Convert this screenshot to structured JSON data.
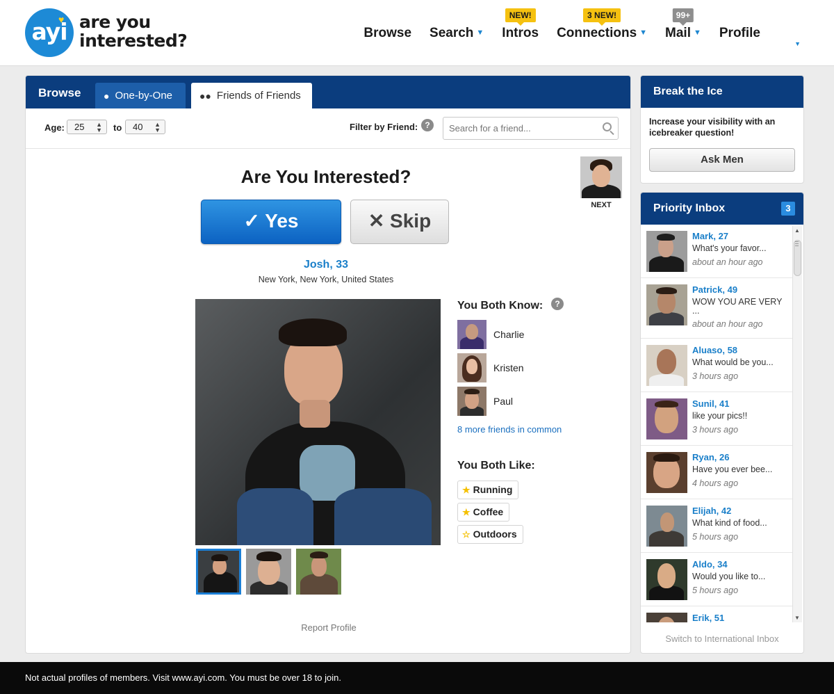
{
  "brand": {
    "logo_mark": "ayi",
    "logo_line1": "are you",
    "logo_line2": "interested?",
    "heart_color": "#ffd21f",
    "brand_blue": "#1d8ad6"
  },
  "nav": {
    "browse": "Browse",
    "search": "Search",
    "intros": "Intros",
    "intros_badge": "NEW!",
    "connections": "Connections",
    "connections_badge": "3 NEW!",
    "mail": "Mail",
    "mail_badge": "99+",
    "profile": "Profile",
    "caret_icon": "chevron-down-icon"
  },
  "browse_panel": {
    "title": "Browse",
    "tabs": [
      {
        "label": "One-by-One",
        "icon": "person-icon",
        "active": false
      },
      {
        "label": "Friends of Friends",
        "icon": "people-icon",
        "active": true
      }
    ],
    "age_label": "Age:",
    "age_min": "25",
    "to_label": "to",
    "age_max": "40",
    "filter_label": "Filter by Friend:",
    "help_glyph": "?",
    "search_placeholder": "Search for a friend..."
  },
  "profile_card": {
    "question": "Are You Interested?",
    "yes_label": "✓ Yes",
    "skip_label": "✕ Skip",
    "next_label": "NEXT",
    "name_age": "Josh, 33",
    "location": "New York, New York, United States",
    "report": "Report Profile",
    "photo_count": 3,
    "active_photo": 1
  },
  "both_know": {
    "title": "You Both Know:",
    "friends": [
      {
        "name": "Charlie"
      },
      {
        "name": "Kristen"
      },
      {
        "name": "Paul"
      }
    ],
    "more": "8 more friends in common"
  },
  "both_like": {
    "title": "You Both Like:",
    "items": [
      "Running",
      "Coffee",
      "Outdoors"
    ],
    "star_color": "#f5c000"
  },
  "break_ice": {
    "title": "Break the Ice",
    "text": "Increase your visibility with an icebreaker question!",
    "button": "Ask Men"
  },
  "priority_inbox": {
    "title": "Priority Inbox",
    "count": "3",
    "messages": [
      {
        "name": "Mark, 27",
        "text": "What's your favor...",
        "time": "about an hour ago"
      },
      {
        "name": "Patrick, 49",
        "text": "WOW YOU ARE VERY ...",
        "time": "about an hour ago"
      },
      {
        "name": "Aluaso, 58",
        "text": "What would be you...",
        "time": "3 hours ago"
      },
      {
        "name": "Sunil, 41",
        "text": "like your pics!!",
        "time": "3 hours ago"
      },
      {
        "name": "Ryan, 26",
        "text": "Have you ever bee...",
        "time": "4 hours ago"
      },
      {
        "name": "Elijah, 42",
        "text": "What kind of food...",
        "time": "5 hours ago"
      },
      {
        "name": "Aldo, 34",
        "text": "Would you like to...",
        "time": "5 hours ago"
      },
      {
        "name": "Erik, 51",
        "text": "",
        "time": ""
      }
    ],
    "switch_link": "Switch to International Inbox"
  },
  "footer": {
    "disclaimer": "Not actual profiles of members. Visit www.ayi.com. You must be over 18 to join."
  }
}
